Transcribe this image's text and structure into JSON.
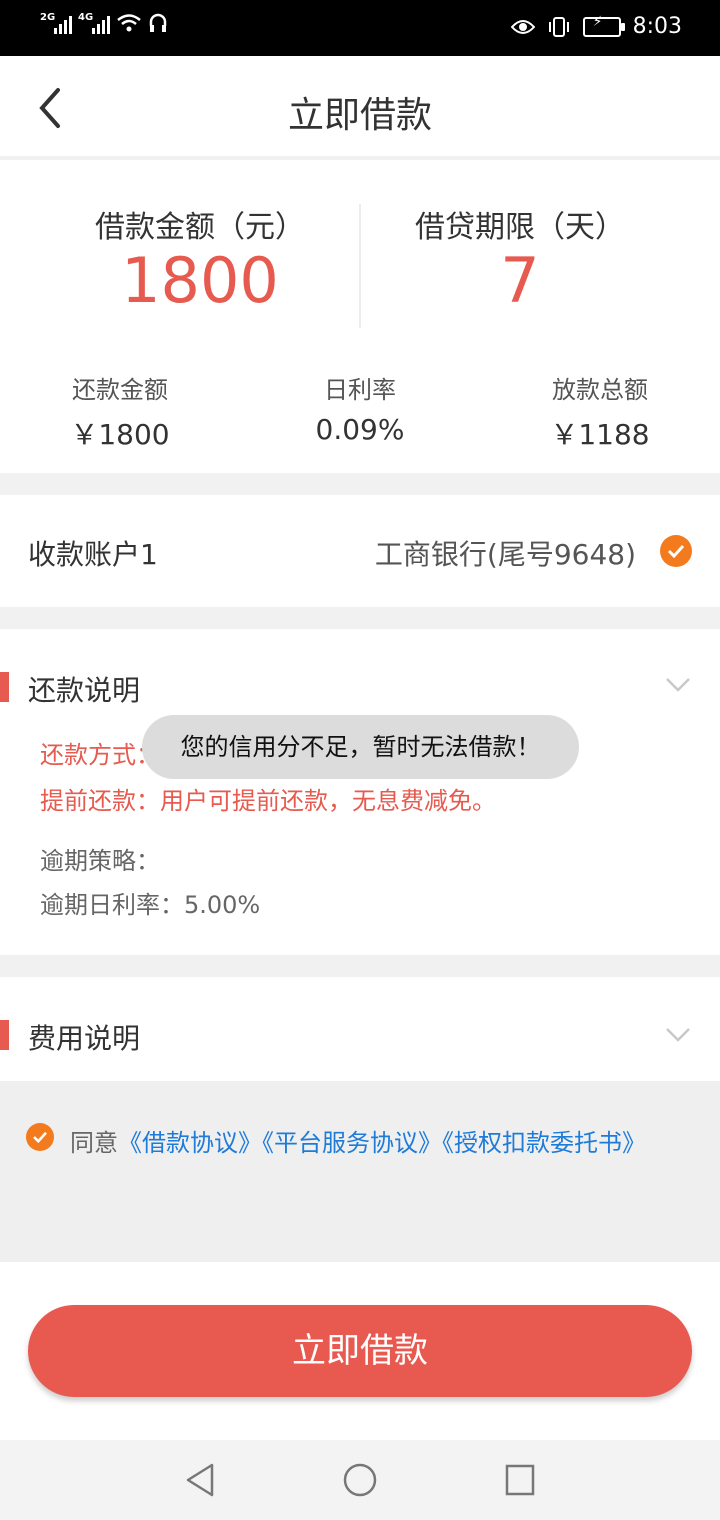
{
  "status_bar": {
    "net1": "2G",
    "net2": "4G",
    "time": "8:03"
  },
  "nav": {
    "title": "立即借款"
  },
  "summary": {
    "amount_caption": "借款金额（元）",
    "amount_value": "1800",
    "term_caption": "借贷期限（天）",
    "term_value": "7",
    "repay_label": "还款金额",
    "repay_value": "￥1800",
    "rate_label": "日利率",
    "rate_value": "0.09%",
    "disburse_label": "放款总额",
    "disburse_value": "￥1188"
  },
  "account": {
    "label": "收款账户1",
    "value": "工商银行(尾号9648)"
  },
  "repay_section": {
    "title": "还款说明",
    "method": "还款方式：",
    "early": "提前还款：用户可提前还款，无息费减免。",
    "overdue_policy": "逾期策略：",
    "overdue_rate": "逾期日利率：5.00%"
  },
  "fee_section": {
    "title": "费用说明"
  },
  "agreement": {
    "prefix": "同意",
    "link1": "《借款协议》",
    "link2": "《平台服务协议》",
    "link3": "《授权扣款委托书》"
  },
  "cta": {
    "label": "立即借款"
  },
  "toast": {
    "message": "您的信用分不足，暂时无法借款！"
  },
  "colors": {
    "accent": "#e65a4f",
    "check": "#f37b1d",
    "link": "#1f7bd8"
  }
}
